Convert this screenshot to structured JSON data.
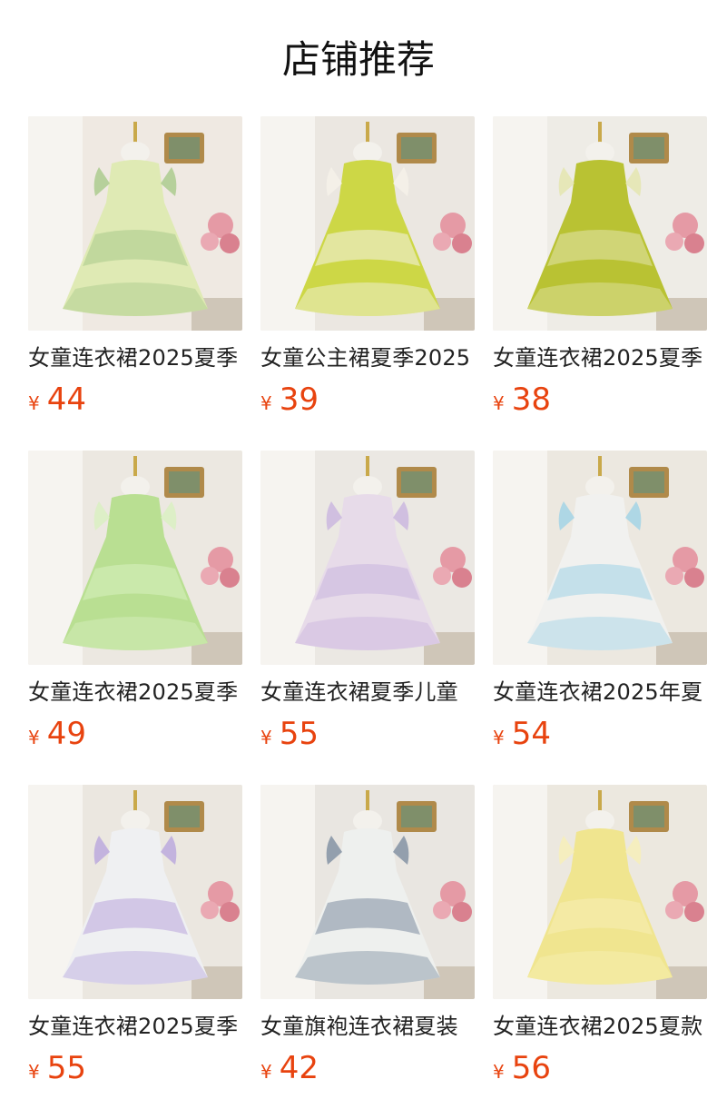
{
  "page": {
    "title": "店铺推荐"
  },
  "currency_symbol": "¥",
  "products": [
    {
      "title": "女童连衣裙2025夏季",
      "price": "44",
      "image": "dress-icon",
      "colors": {
        "bg": "#efe9e2",
        "dress": "#dfeab4",
        "accent": "#a8c98a"
      }
    },
    {
      "title": "女童公主裙夏季2025",
      "price": "39",
      "image": "dress-icon",
      "colors": {
        "bg": "#ebe7e1",
        "dress": "#cdd746",
        "accent": "#f6f3ea"
      }
    },
    {
      "title": "女童连衣裙2025夏季",
      "price": "38",
      "image": "dress-icon",
      "colors": {
        "bg": "#eeece6",
        "dress": "#b9c233",
        "accent": "#e4e6ad"
      }
    },
    {
      "title": "女童连衣裙2025夏季",
      "price": "49",
      "image": "dress-icon",
      "colors": {
        "bg": "#ece8e1",
        "dress": "#b9df92",
        "accent": "#d9f0c0"
      }
    },
    {
      "title": "女童连衣裙夏季儿童",
      "price": "55",
      "image": "dress-icon",
      "colors": {
        "bg": "#ebe8e3",
        "dress": "#e7dbe9",
        "accent": "#c9b4de"
      }
    },
    {
      "title": "女童连衣裙2025年夏",
      "price": "54",
      "image": "dress-icon",
      "colors": {
        "bg": "#ece8e0",
        "dress": "#f1f1ef",
        "accent": "#9fd2e6"
      }
    },
    {
      "title": "女童连衣裙2025夏季",
      "price": "55",
      "image": "dress-icon",
      "colors": {
        "bg": "#ebe7e0",
        "dress": "#eff0f2",
        "accent": "#b9a6dd"
      }
    },
    {
      "title": "女童旗袍连衣裙夏装",
      "price": "42",
      "image": "dress-icon",
      "colors": {
        "bg": "#e9e6e1",
        "dress": "#eef0ee",
        "accent": "#7d8da0"
      }
    },
    {
      "title": "女童连衣裙2025夏款",
      "price": "56",
      "image": "dress-icon",
      "colors": {
        "bg": "#ece8df",
        "dress": "#f0e58f",
        "accent": "#f7efb6"
      }
    }
  ]
}
